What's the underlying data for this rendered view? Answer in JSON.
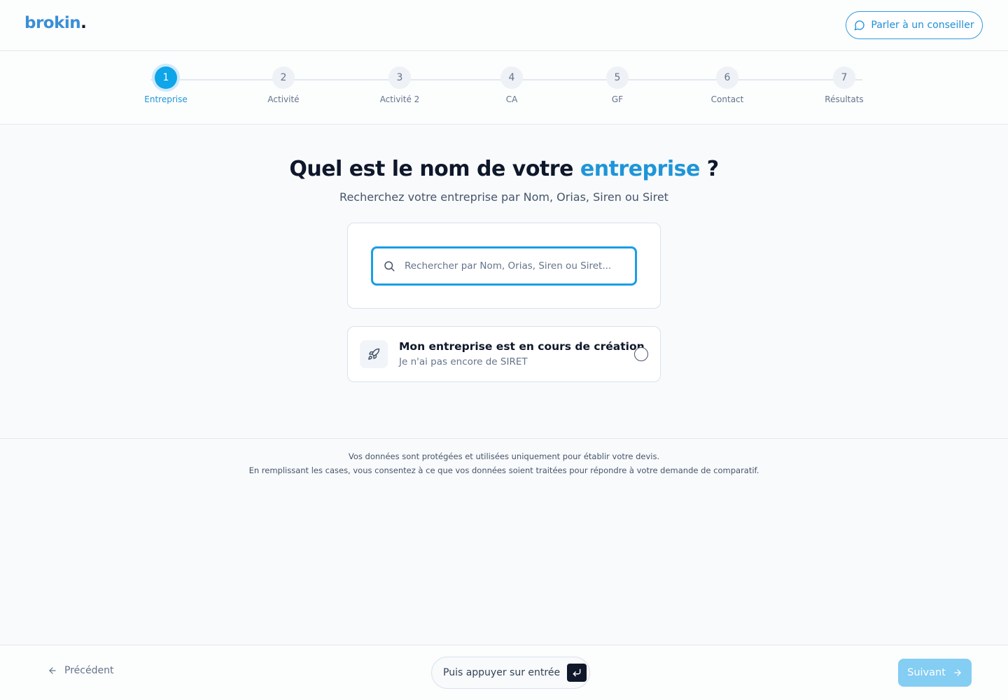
{
  "header": {
    "logo_text": "brokin",
    "logo_dot": ".",
    "advisor_button": "Parler à un conseiller",
    "advisor_icon": "chat-bubble-icon"
  },
  "stepper": {
    "current": 1,
    "steps": [
      {
        "number": "1",
        "label": "Entreprise"
      },
      {
        "number": "2",
        "label": "Activité"
      },
      {
        "number": "3",
        "label": "Activité 2"
      },
      {
        "number": "4",
        "label": "CA"
      },
      {
        "number": "5",
        "label": "GF"
      },
      {
        "number": "6",
        "label": "Contact"
      },
      {
        "number": "7",
        "label": "Résultats"
      }
    ]
  },
  "main": {
    "title_prefix": "Quel est le nom de votre ",
    "title_accent": "entreprise",
    "title_suffix": " ?",
    "subtitle": "Recherchez votre entreprise par Nom, Orias, Siren ou Siret",
    "search": {
      "placeholder": "Rechercher par Nom, Orias, Siren ou Siret...",
      "value": "",
      "icon": "search-icon"
    },
    "creation_option": {
      "title": "Mon entreprise est en cours de création",
      "subtitle": "Je n'ai pas encore de SIRET",
      "icon": "rocket-icon",
      "selected": false
    }
  },
  "privacy": {
    "line1": "Vos données sont protégées et utilisées uniquement pour établir votre devis.",
    "line2": "En remplissant les cases, vous consentez à ce que vos données soient traitées pour répondre à votre demande de comparatif."
  },
  "footer": {
    "previous_label": "Précédent",
    "enter_hint": "Puis appuyer sur entrée",
    "next_label": "Suivant"
  },
  "colors": {
    "accent": "#0ea5e9",
    "brand_blue": "#3a8fd6",
    "next_button_disabled": "#84cdf3",
    "text_dark": "#0f172a"
  }
}
